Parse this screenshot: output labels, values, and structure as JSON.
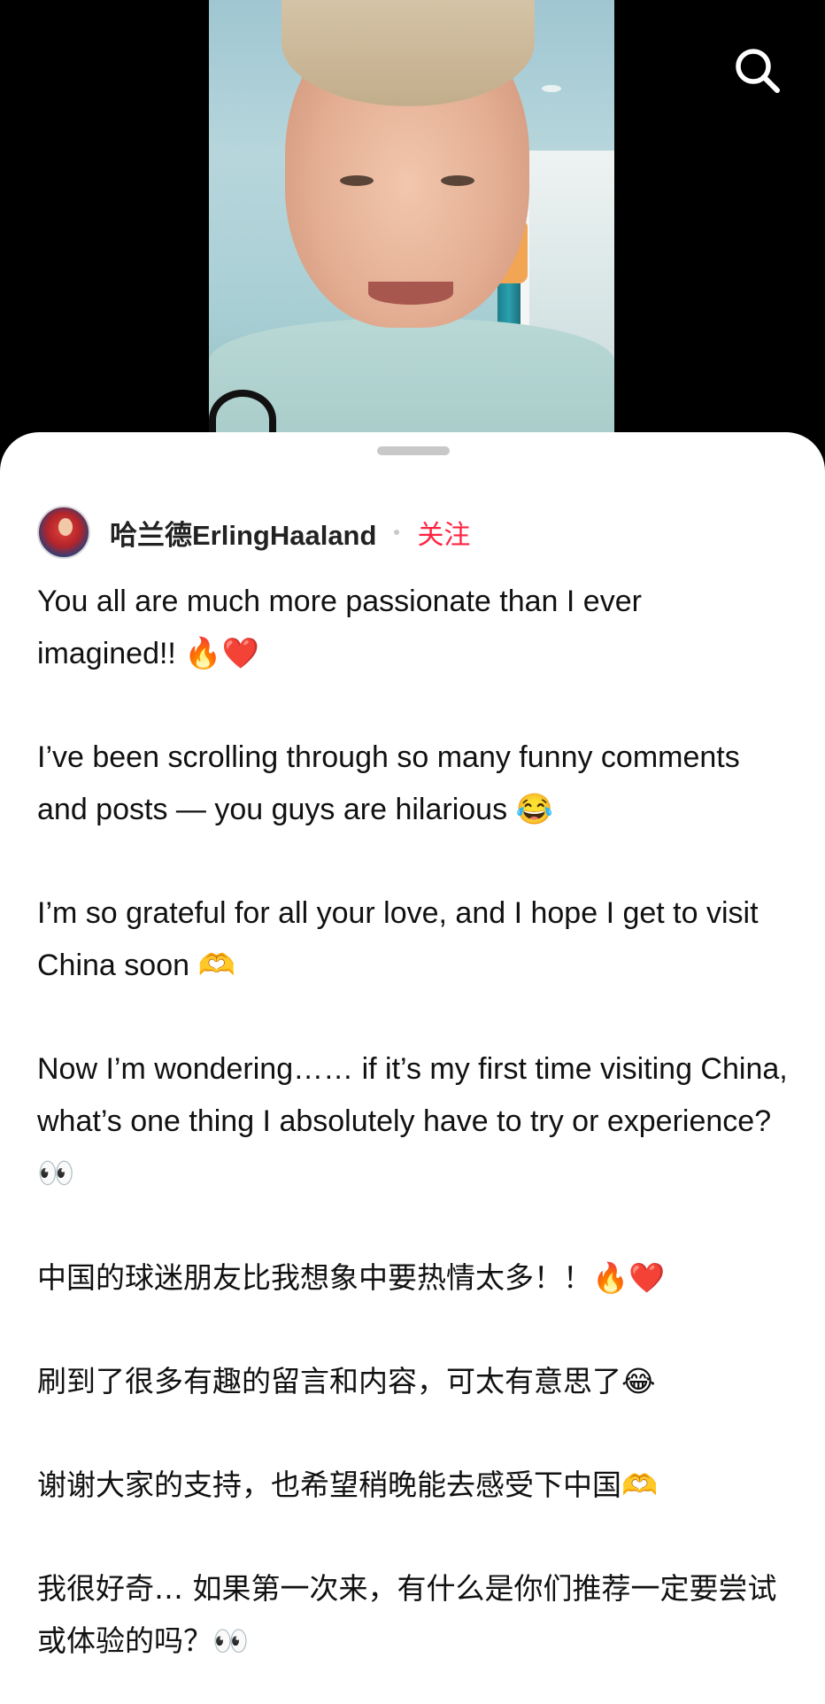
{
  "search": {
    "icon": "search-icon"
  },
  "post": {
    "author": "哈兰德ErlingHaaland",
    "separator": "·",
    "follow_label": "关注",
    "paragraphs": [
      "You all are much more passionate than I ever imagined!! 🔥❤️",
      "I’ve been scrolling through so many funny comments and posts — you guys are hilarious 😂",
      "I’m so grateful for all your love, and I hope I get to visit China soon 🫶",
      "Now I’m wondering…… if it’s my first time visiting China, what’s one thing I absolutely have to try or experience? 👀",
      "中国的球迷朋友比我想象中要热情太多！！🔥❤️",
      "刷到了很多有趣的留言和内容，可太有意思了😂",
      "谢谢大家的支持，也希望稍晚能去感受下中国🫶",
      "我很好奇… 如果第一次来，有什么是你们推荐一定要尝试或体验的吗？👀"
    ]
  },
  "colors": {
    "follow": "#ff2442",
    "text": "#111111",
    "sheet": "#ffffff",
    "background": "#000000"
  }
}
